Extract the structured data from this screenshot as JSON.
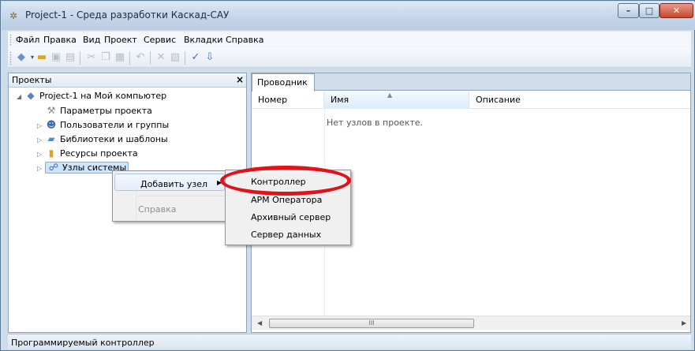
{
  "window": {
    "title": "Project-1 - Среда разработки Каскад-САУ",
    "controls": {
      "minimize": "–",
      "maximize": "□",
      "close": "✕"
    }
  },
  "menu": [
    "Файл",
    "Правка",
    "Вид",
    "Проект",
    "Сервис",
    "Вкладки",
    "Справка"
  ],
  "toolbar": {
    "icons": [
      "add-dropdown-icon",
      "open-folder-icon",
      "save-icon",
      "save-all-icon",
      "cut-icon",
      "copy-icon",
      "paste-icon",
      "undo-icon",
      "delete-icon",
      "properties-icon",
      "spellcheck-icon",
      "export-icon"
    ]
  },
  "projects_panel": {
    "title": "Проекты",
    "close": "×",
    "tree": [
      {
        "label": "Project-1 на Мой компьютер",
        "icon": "project-icon"
      },
      {
        "label": "Параметры проекта",
        "icon": "settings-icon"
      },
      {
        "label": "Пользователи и группы",
        "icon": "users-icon"
      },
      {
        "label": "Библиотеки и шаблоны",
        "icon": "library-icon"
      },
      {
        "label": "Ресурсы проекта",
        "icon": "resources-icon"
      },
      {
        "label": "Узлы системы",
        "icon": "network-nodes-icon"
      }
    ]
  },
  "explorer": {
    "tab": "Проводник",
    "columns": [
      "Номер",
      "Имя",
      "Описание"
    ],
    "empty_message": "Нет узлов в проекте.",
    "scroll": {
      "thumb_grip": "III"
    }
  },
  "context_menu": {
    "items": [
      {
        "label": "Добавить узел",
        "submenu": true,
        "enabled": true
      },
      {
        "label": "Справка",
        "enabled": false
      }
    ]
  },
  "submenu": [
    "Контроллер",
    "АРМ Оператора",
    "Архивный сервер",
    "Сервер данных"
  ],
  "status_bar": {
    "text": "Программируемый контроллер"
  },
  "colors": {
    "highlight_ellipse": "#e0131a",
    "selection": "#cde4fb"
  }
}
